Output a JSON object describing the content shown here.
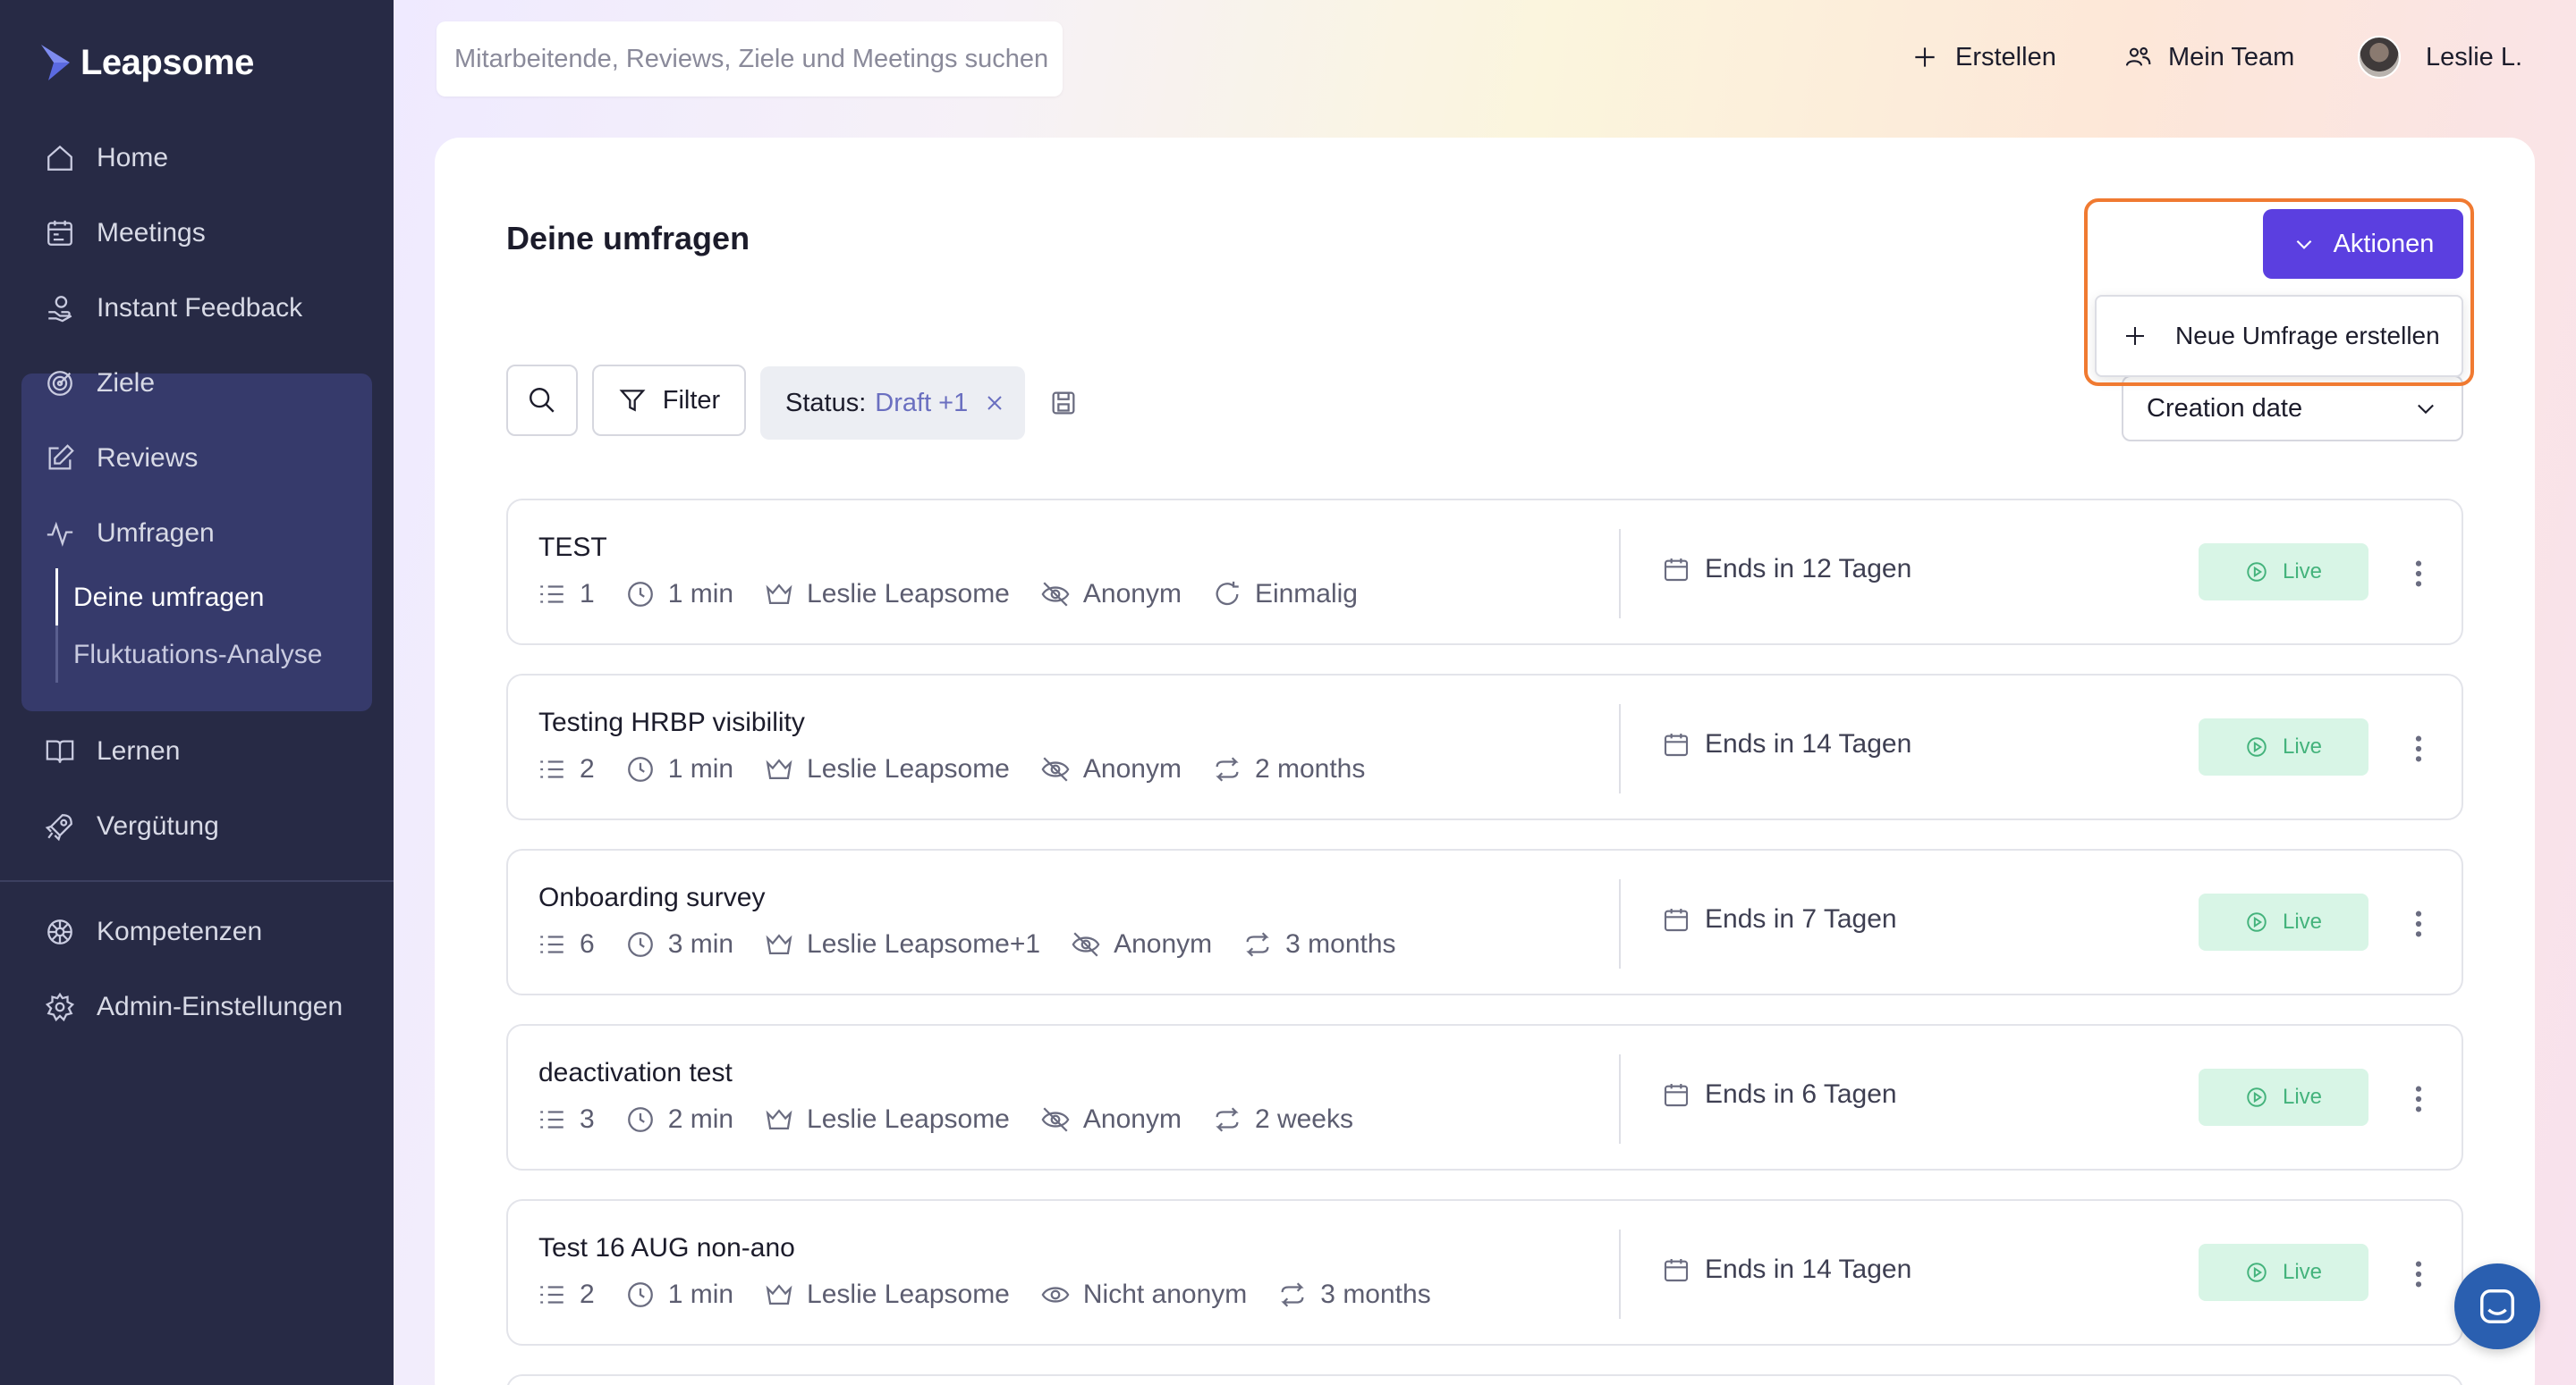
{
  "app": {
    "logo_text": "Leapsome"
  },
  "sidebar": {
    "items": [
      {
        "label": "Home",
        "icon": "home-icon"
      },
      {
        "label": "Meetings",
        "icon": "meetings-icon"
      },
      {
        "label": "Instant Feedback",
        "icon": "feedback-icon"
      },
      {
        "label": "Ziele",
        "icon": "target-icon"
      },
      {
        "label": "Reviews",
        "icon": "edit-icon"
      },
      {
        "label": "Umfragen",
        "icon": "pulse-icon",
        "active": true
      },
      {
        "label": "Lernen",
        "icon": "book-icon"
      },
      {
        "label": "Vergütung",
        "icon": "rocket-icon"
      },
      {
        "label": "Kompetenzen",
        "icon": "competency-icon"
      },
      {
        "label": "Admin-Einstellungen",
        "icon": "gear-icon"
      }
    ],
    "sub_items": [
      {
        "label": "Deine umfragen",
        "active": true
      },
      {
        "label": "Fluktuations-Analyse"
      }
    ]
  },
  "header": {
    "search_placeholder": "Mitarbeitende, Reviews, Ziele und Meetings suchen",
    "create_label": "Erstellen",
    "team_label": "Mein Team",
    "user_name": "Leslie L."
  },
  "main": {
    "title": "Deine umfragen",
    "filter_label": "Filter",
    "status_chip": {
      "label": "Status:",
      "value": "Draft +1"
    },
    "sort_value": "Creation date",
    "actions_label": "Aktionen",
    "dropdown_item": "Neue Umfrage erstellen",
    "live_label": "Live",
    "surveys": [
      {
        "title": "TEST",
        "questions": "1",
        "duration": "1 min",
        "owner": "Leslie Leapsome",
        "anonymity": "Anonym",
        "recurrence": "Einmalig",
        "recurrence_icon": "refresh-icon",
        "anon_icon": "eye-off-icon",
        "ends": "Ends in 12 Tagen"
      },
      {
        "title": "Testing HRBP visibility",
        "questions": "2",
        "duration": "1 min",
        "owner": "Leslie Leapsome",
        "anonymity": "Anonym",
        "recurrence": "2 months",
        "recurrence_icon": "repeat-icon",
        "anon_icon": "eye-off-icon",
        "ends": "Ends in 14 Tagen"
      },
      {
        "title": "Onboarding survey",
        "questions": "6",
        "duration": "3 min",
        "owner": "Leslie Leapsome+1",
        "anonymity": "Anonym",
        "recurrence": "3 months",
        "recurrence_icon": "repeat-icon",
        "anon_icon": "eye-off-icon",
        "ends": "Ends in 7 Tagen"
      },
      {
        "title": "deactivation test",
        "questions": "3",
        "duration": "2 min",
        "owner": "Leslie Leapsome",
        "anonymity": "Anonym",
        "recurrence": "2 weeks",
        "recurrence_icon": "repeat-icon",
        "anon_icon": "eye-off-icon",
        "ends": "Ends in 6 Tagen"
      },
      {
        "title": "Test 16 AUG non-ano",
        "questions": "2",
        "duration": "1 min",
        "owner": "Leslie Leapsome",
        "anonymity": "Nicht anonym",
        "recurrence": "3 months",
        "recurrence_icon": "repeat-icon",
        "anon_icon": "eye-icon",
        "ends": "Ends in 14 Tagen"
      }
    ]
  },
  "colors": {
    "sidebar_bg": "#272a45",
    "accent": "#5b3fe0",
    "highlight": "#f07a31",
    "live_bg": "#d8f5e6",
    "live_text": "#44b37c"
  }
}
